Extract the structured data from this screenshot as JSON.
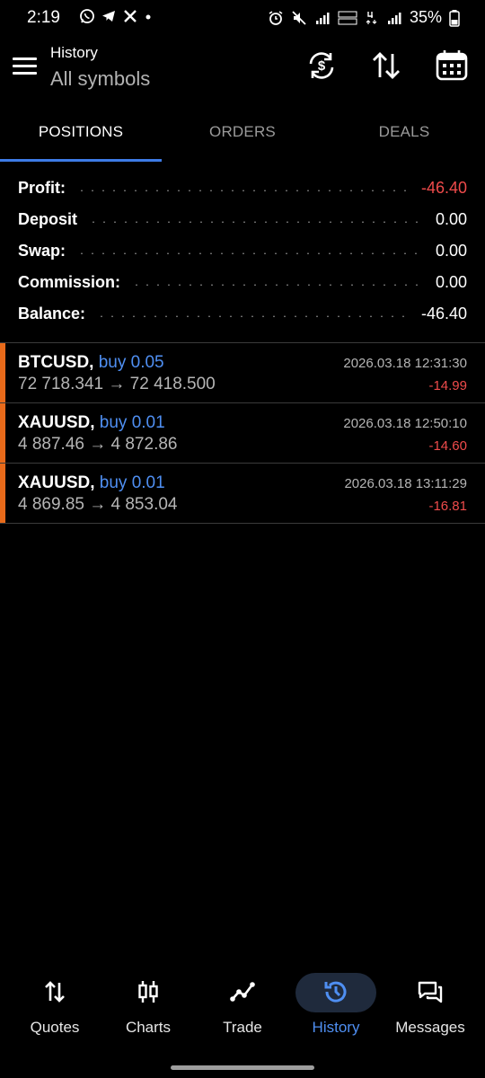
{
  "status_bar": {
    "time": "2:19",
    "battery": "35%",
    "left_icons": [
      "whatsapp-icon",
      "telegram-icon",
      "x-icon",
      "dot-icon"
    ],
    "right_icons": [
      "alarm-icon",
      "mute-icon",
      "signal-icon",
      "volte-icon",
      "4g-icon",
      "signal-icon-2",
      "battery-icon"
    ]
  },
  "header": {
    "title": "History",
    "subtitle": "All symbols",
    "actions": [
      "refresh-currency-icon",
      "sort-icon",
      "calendar-icon"
    ]
  },
  "tabs": [
    {
      "label": "POSITIONS",
      "active": true
    },
    {
      "label": "ORDERS",
      "active": false
    },
    {
      "label": "DEALS",
      "active": false
    }
  ],
  "summary": [
    {
      "label": "Profit:",
      "value": "-46.40",
      "negative": true
    },
    {
      "label": "Deposit",
      "value": "0.00",
      "negative": false
    },
    {
      "label": "Swap:",
      "value": "0.00",
      "negative": false
    },
    {
      "label": "Commission:",
      "value": "0.00",
      "negative": false
    },
    {
      "label": "Balance:",
      "value": "-46.40",
      "negative": false
    }
  ],
  "deals": [
    {
      "symbol": "BTCUSD,",
      "side": "buy 0.05",
      "prices": "72 718.341 → 72 418.500",
      "time": "2026.03.18 12:31:30",
      "profit": "-14.99"
    },
    {
      "symbol": "XAUUSD,",
      "side": "buy 0.01",
      "prices": "4 887.46 → 4 872.86",
      "time": "2026.03.18 12:50:10",
      "profit": "-14.60"
    },
    {
      "symbol": "XAUUSD,",
      "side": "buy 0.01",
      "prices": "4 869.85 → 4 853.04",
      "time": "2026.03.18 13:11:29",
      "profit": "-16.81"
    }
  ],
  "bottom_nav": [
    {
      "label": "Quotes",
      "icon": "quotes-arrows-icon",
      "active": false
    },
    {
      "label": "Charts",
      "icon": "candlestick-icon",
      "active": false
    },
    {
      "label": "Trade",
      "icon": "trade-line-icon",
      "active": false
    },
    {
      "label": "History",
      "icon": "history-clock-icon",
      "active": true
    },
    {
      "label": "Messages",
      "icon": "messages-icon",
      "active": false
    }
  ],
  "colors": {
    "background": "#000000",
    "accent_blue": "#3d7be6",
    "negative_red": "#ef4b4b",
    "buy_blue": "#4f8ff2",
    "position_bar_orange": "#e86a1a"
  }
}
